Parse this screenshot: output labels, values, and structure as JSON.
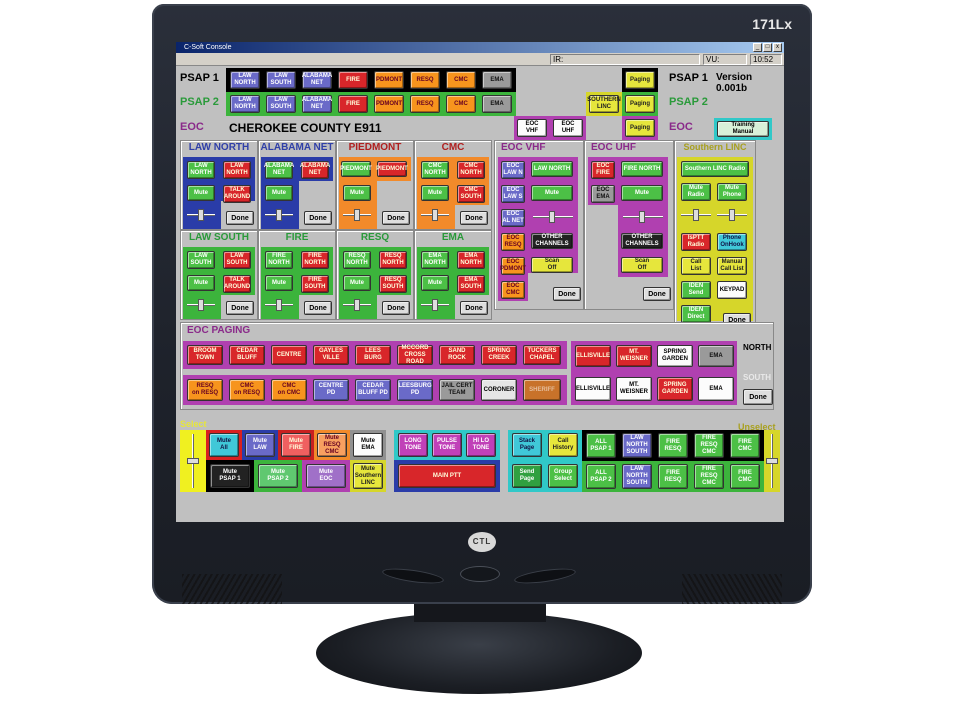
{
  "monitor": {
    "model": "171Lx",
    "brand": "CTL"
  },
  "window": {
    "title": "C-Soft Console",
    "controls": [
      "_",
      "□",
      "x"
    ]
  },
  "statusbar": {
    "ir_label": "IR:",
    "vu_label": "VU:",
    "clock": "10:52"
  },
  "header": {
    "psap1_label": "PSAP 1",
    "psap2_label": "PSAP 2",
    "eoc_label": "EOC",
    "county_title": "CHEROKEE COUNTY E911",
    "version": "Version 0.001b",
    "psap1_right": "PSAP 1",
    "psap2_right": "PSAP 2",
    "eoc_right": "EOC",
    "training_manual": "Training\nManual",
    "psap1_buttons": [
      "LAW\nNORTH",
      "LAW\nSOUTH",
      "ALABAMA\nNET",
      "FIRE",
      "PDMONT",
      "RESQ",
      "CMC",
      "EMA"
    ],
    "psap2_buttons": [
      "LAW\nNORTH",
      "LAW\nSOUTH",
      "ALABAMA\nNET",
      "FIRE",
      "PDMONT",
      "RESQ",
      "CMC",
      "EMA"
    ],
    "eoc_buttons": [
      "EOC\nVHF",
      "EOC\nUHF"
    ],
    "southern_linc": "SOUTHERN\nLINC",
    "paging": [
      "Paging",
      "Paging",
      "Paging"
    ]
  },
  "panels": {
    "law_north": {
      "title": "LAW NORTH",
      "b1": "LAW\nNORTH",
      "b2": "LAW\nNORTH",
      "mute": "Mute",
      "b4": "TALK\nAROUND",
      "done": "Done"
    },
    "alabama_net": {
      "title": "ALABAMA NET",
      "b1": "ALABAMA\nNET",
      "b2": "ALABAMA\nNET",
      "mute": "Mute",
      "done": "Done"
    },
    "piedmont": {
      "title": "PIEDMONT",
      "b1": "PIEDMONT",
      "b2": "PIEDMONT",
      "mute": "Mute",
      "done": "Done"
    },
    "cmc": {
      "title": "CMC",
      "b1": "CMC\nNORTH",
      "b2": "CMC\nNORTH",
      "mute": "Mute",
      "b4": "CMC\nSOUTH",
      "done": "Done"
    },
    "law_south": {
      "title": "LAW SOUTH",
      "b1": "LAW\nSOUTH",
      "b2": "LAW\nSOUTH",
      "mute": "Mute",
      "b4": "TALK\nAROUND",
      "done": "Done"
    },
    "fire": {
      "title": "FIRE",
      "b1": "FIRE\nNORTH",
      "b2": "FIRE\nNORTH",
      "mute": "Mute",
      "b4": "FIRE\nSOUTH",
      "done": "Done"
    },
    "resq": {
      "title": "RESQ",
      "b1": "RESQ\nNORTH",
      "b2": "RESQ\nNORTH",
      "mute": "Mute",
      "b4": "RESQ\nSOUTH",
      "done": "Done"
    },
    "ema": {
      "title": "EMA",
      "b1": "EMA\nNORTH",
      "b2": "EMA\nNORTH",
      "mute": "Mute",
      "b4": "EMA\nSOUTH",
      "done": "Done"
    },
    "eoc_vhf": {
      "title": "EOC VHF",
      "left": [
        "EOC\nLAW N",
        "EOC\nLAW S",
        "EOC\nAL NET",
        "EOC\nRESQ",
        "EOC\nPDMONT",
        "EOC\nCMC"
      ],
      "law_north": "LAW NORTH",
      "mute": "Mute",
      "other": "OTHER\nCHANNELS",
      "scan": "Scan\nOff",
      "done": "Done"
    },
    "eoc_uhf": {
      "title": "EOC UHF",
      "left": [
        "EOC\nFIRE",
        "EOC\nEMA"
      ],
      "fire_north": "FIRE NORTH",
      "mute": "Mute",
      "other": "OTHER\nCHANNELS",
      "scan": "Scan\nOff",
      "done": "Done"
    },
    "southern_linc": {
      "title": "Southern LINC",
      "radio": "Southern LINC Radio",
      "mute_radio": "Mute\nRadio",
      "mute_phone": "Mute\nPhone",
      "isptt": "IsPTT\nRadio",
      "phone_onhook": "Phone\nOnHook",
      "call_list": "Call\nList",
      "manual_call_list": "Manual\nCall List",
      "iden_send": "IDEN\nSend",
      "keypad": "KEYPAD",
      "iden_direct": "IDEN\nDirect",
      "done": "Done"
    }
  },
  "eoc_paging": {
    "title": "EOC PAGING",
    "row1": [
      "BROOM\nTOWN",
      "CEDAR\nBLUFF",
      "CENTRE",
      "GAYLES\nVILLE",
      "LEES\nBURG",
      "MCCORD\nCROSS\nROAD",
      "SAND\nROCK",
      "SPRING\nCREEK",
      "TUCKERS\nCHAPEL"
    ],
    "row2": [
      "RESQ\non RESQ",
      "CMC\non RESQ",
      "CMC\non CMC",
      "CENTRE\nPD",
      "CEDAR\nBLUFF PD",
      "LEESBURG\nPD",
      "JAIL CERT\nTEAM",
      "CORONER",
      "SHERIFF"
    ],
    "north_row": [
      "ELLISVILLE",
      "MT.\nWEISNER",
      "SPRING\nGARDEN",
      "EMA"
    ],
    "south_row": [
      "ELLISVILLE",
      "MT.\nWEISNER",
      "SPRING\nGARDEN",
      "EMA"
    ],
    "north_label": "NORTH",
    "south_label": "SOUTH",
    "done": "Done"
  },
  "bottom": {
    "select_label": "Select",
    "unselect_label": "Unselect",
    "mutes_row1": [
      "Mute\nAll",
      "Mute\nLAW",
      "Mute\nFIRE",
      "Mute\nRESQ\nCMC",
      "Mute\nEMA"
    ],
    "mutes_row2": [
      "Mute\nPSAP 1",
      "Mute\nPSAP 2",
      "Mute\nEOC",
      "Mute\nSouthern\nLINC"
    ],
    "tones": [
      "LONG\nTONE",
      "PULSE\nTONE",
      "HI LO\nTONE"
    ],
    "main_ptt": "MAIN PTT",
    "stack_page": "Stack\nPage",
    "call_history": "Call\nHistory",
    "send_page": "Send\nPage",
    "group_select": "Group\nSelect",
    "psap1_group": [
      "ALL\nPSAP 1",
      "LAW\nNORTH\nSOUTH",
      "FIRE\nRESQ",
      "FIRE\nRESQ\nCMC",
      "FIRE\nCMC"
    ],
    "psap2_group": [
      "ALL\nPSAP 2",
      "LAW\nNORTH\nSOUTH",
      "FIRE\nRESQ",
      "FIRE\nRESQ\nCMC",
      "FIRE\nCMC"
    ]
  }
}
